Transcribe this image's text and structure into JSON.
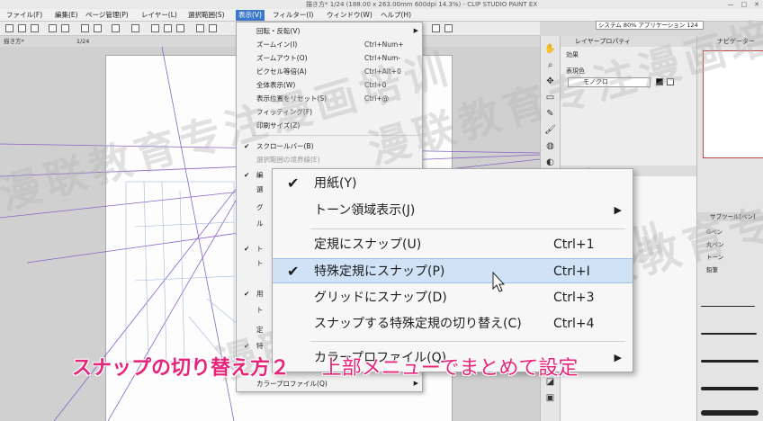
{
  "window": {
    "title": "描き方* 1/24 (188.00 x 263.00mm 600dpi 14.3%) - CLIP STUDIO PAINT EX",
    "controls": [
      "—",
      "□",
      "✕"
    ]
  },
  "menubar": {
    "items": [
      {
        "label": "ファイル(F)"
      },
      {
        "label": "編集(E)"
      },
      {
        "label": "ページ管理(P)"
      },
      {
        "label": "レイヤー(L)"
      },
      {
        "label": "選択範囲(S)"
      },
      {
        "label": "表示(V)"
      },
      {
        "label": "フィルター(I)"
      },
      {
        "label": "ウィンドウ(W)"
      },
      {
        "label": "ヘルプ(H)"
      }
    ],
    "status": "システム 80%  アプリケーション 124"
  },
  "document_tab": {
    "name": "描き方*",
    "page": "1/24"
  },
  "view_menu": {
    "items": [
      {
        "label": "回転・反転(V)",
        "shortcut": "",
        "submenu": true,
        "checked": false,
        "disabled": false
      },
      {
        "label": "ズームイン(I)",
        "shortcut": "Ctrl+Num+",
        "submenu": false,
        "checked": false,
        "disabled": false
      },
      {
        "label": "ズームアウト(O)",
        "shortcut": "Ctrl+Num-",
        "submenu": false,
        "checked": false,
        "disabled": false
      },
      {
        "label": "ピクセル等倍(A)",
        "shortcut": "Ctrl+Alt+0",
        "submenu": false,
        "checked": false,
        "disabled": false
      },
      {
        "label": "全体表示(W)",
        "shortcut": "Ctrl+0",
        "submenu": false,
        "checked": false,
        "disabled": false
      },
      {
        "label": "表示位置をリセット(S)",
        "shortcut": "Ctrl+@",
        "submenu": false,
        "checked": false,
        "disabled": false
      },
      {
        "label": "フィッティング(F)",
        "shortcut": "",
        "submenu": false,
        "checked": false,
        "disabled": false
      },
      {
        "label": "印刷サイズ(Z)",
        "shortcut": "",
        "submenu": false,
        "checked": false,
        "disabled": false
      },
      {
        "label": "スクロールバー(B)",
        "shortcut": "",
        "submenu": false,
        "checked": true,
        "disabled": false
      },
      {
        "label": "選択範囲の境界線(E)",
        "shortcut": "",
        "submenu": false,
        "checked": false,
        "disabled": true
      }
    ],
    "partial_items": [
      {
        "label": "編",
        "checked": true
      },
      {
        "label": "選",
        "checked": false
      },
      {
        "label": "グ",
        "checked": false
      },
      {
        "label": "ル",
        "checked": false
      },
      {
        "label": "ト",
        "checked": true
      },
      {
        "label": "ト",
        "checked": false
      },
      {
        "label": "用",
        "checked": true
      },
      {
        "label": "ト",
        "checked": false
      },
      {
        "label": "定",
        "checked": false
      },
      {
        "label": "特",
        "checked": true
      },
      {
        "label": "グ",
        "checked": false
      }
    ],
    "bottom_item": {
      "label": "カラープロファイル(Q)",
      "submenu": true
    }
  },
  "snap_submenu": {
    "items": [
      {
        "label": "用紙(Y)",
        "shortcut": "",
        "checked": true,
        "submenu": false,
        "highlight": false
      },
      {
        "label": "トーン領域表示(J)",
        "shortcut": "",
        "checked": false,
        "submenu": true,
        "highlight": false
      },
      {
        "label": "定規にスナップ(U)",
        "shortcut": "Ctrl+1",
        "checked": false,
        "submenu": false,
        "highlight": false
      },
      {
        "label": "特殊定規にスナップ(P)",
        "shortcut": "Ctrl+I",
        "checked": true,
        "submenu": false,
        "highlight": true
      },
      {
        "label": "グリッドにスナップ(D)",
        "shortcut": "Ctrl+3",
        "checked": false,
        "submenu": false,
        "highlight": false
      },
      {
        "label": "スナップする特殊定規の切り替え(C)",
        "shortcut": "Ctrl+4",
        "checked": false,
        "submenu": false,
        "highlight": false
      },
      {
        "label": "カラープロファイル(Q)",
        "shortcut": "",
        "checked": false,
        "submenu": true,
        "highlight": false
      }
    ]
  },
  "properties_panel": {
    "header": "レイヤープロパティ",
    "effect_label": "効果",
    "display_color_label": "表現色",
    "display_color_value": "モノクロ",
    "layer_header": "レイヤー"
  },
  "navigator_panel": {
    "header": "ナビゲーター"
  },
  "subtool_panel": {
    "header": "サブツール[ペン]",
    "tools": [
      "Gペン",
      "丸ペン",
      "トーン",
      "鉛筆"
    ],
    "brush_sizes": [
      "3",
      "5",
      "8",
      "10",
      "15",
      "25",
      "40",
      "80"
    ]
  },
  "watermarks": [
    "漫联教育专注漫画培训",
    "漫联教育专注漫画培训",
    "漫联教育专注漫画培训",
    "漫联教育专注漫画培训"
  ],
  "caption": {
    "part1": "スナップの切り替え方２",
    "part2": "上部メニューでまとめて設定",
    "color": "#e8247a"
  },
  "colors": {
    "menu_highlight": "#3c78c8",
    "submenu_highlight": "#cfe2f6"
  }
}
